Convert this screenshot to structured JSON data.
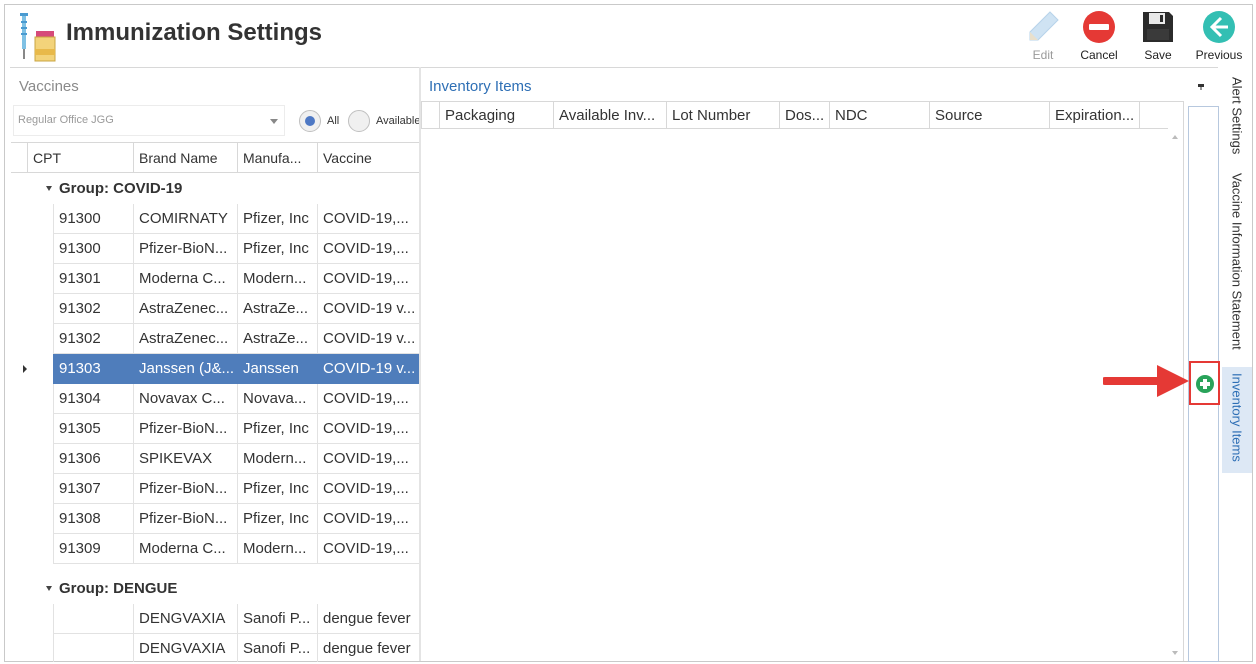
{
  "header": {
    "title": "Immunization Settings",
    "toolbar": {
      "edit": "Edit",
      "cancel": "Cancel",
      "save": "Save",
      "previous": "Previous"
    }
  },
  "vaccines": {
    "panel_title": "Vaccines",
    "office_select": "Regular Office JGG",
    "filter": {
      "all": "All",
      "available": "Available"
    },
    "columns": [
      "CPT",
      "Brand Name",
      "Manufa...",
      "Vaccine"
    ],
    "groups": [
      {
        "label": "Group: COVID-19",
        "rows": [
          [
            "91300",
            "COMIRNATY",
            "Pfizer, Inc",
            "COVID-19,..."
          ],
          [
            "91300",
            "Pfizer-BioN...",
            "Pfizer, Inc",
            "COVID-19,..."
          ],
          [
            "91301",
            "Moderna C...",
            "Modern...",
            "COVID-19,..."
          ],
          [
            "91302",
            "AstraZenec...",
            "AstraZe...",
            "COVID-19 v..."
          ],
          [
            "91302",
            "AstraZenec...",
            "AstraZe...",
            "COVID-19 v..."
          ],
          [
            "91303",
            "Janssen (J&...",
            "Janssen",
            "COVID-19 v..."
          ],
          [
            "91304",
            "Novavax C...",
            "Novava...",
            "COVID-19,..."
          ],
          [
            "91305",
            "Pfizer-BioN...",
            "Pfizer, Inc",
            "COVID-19,..."
          ],
          [
            "91306",
            "SPIKEVAX",
            "Modern...",
            "COVID-19,..."
          ],
          [
            "91307",
            "Pfizer-BioN...",
            "Pfizer, Inc",
            "COVID-19,..."
          ],
          [
            "91308",
            "Pfizer-BioN...",
            "Pfizer, Inc",
            "COVID-19,..."
          ],
          [
            "91309",
            "Moderna C...",
            "Modern...",
            "COVID-19,..."
          ]
        ]
      },
      {
        "label": "Group: DENGUE",
        "rows": [
          [
            "",
            "DENGVAXIA",
            "Sanofi P...",
            "dengue fever"
          ],
          [
            "",
            "DENGVAXIA",
            "Sanofi P...",
            "dengue fever"
          ]
        ]
      }
    ],
    "selected_row_index": 5
  },
  "inventory": {
    "panel_title": "Inventory Items",
    "columns": [
      "Packaging",
      "Available Inv...",
      "Lot Number",
      "Dos...",
      "NDC",
      "Source",
      "Expiration..."
    ]
  },
  "side_tabs": [
    "Alert Settings",
    "Vaccine Information Statement",
    "Inventory Items"
  ],
  "colors": {
    "accent": "#2e6fb5",
    "selected_row": "#4f7dbb",
    "add_button": "#29a35a",
    "annotation": "#e53935"
  }
}
